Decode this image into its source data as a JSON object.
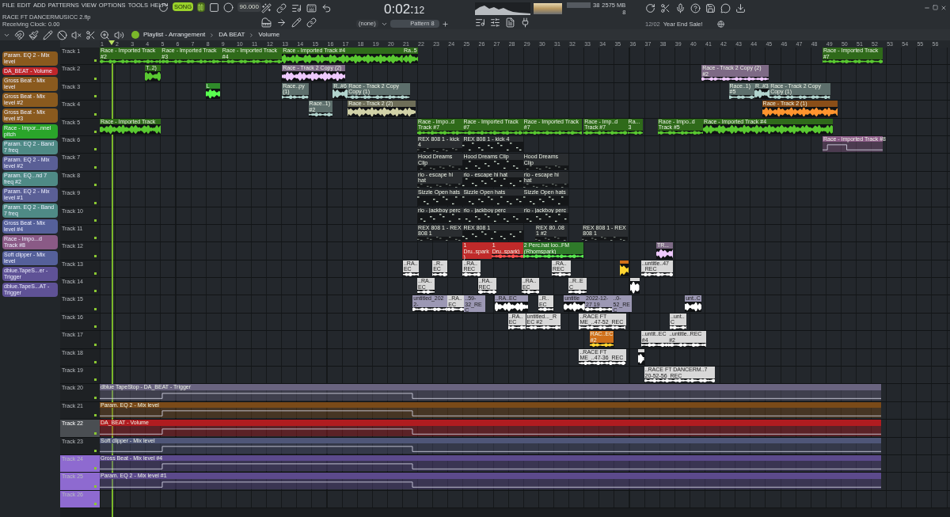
{
  "menu": [
    "FILE",
    "EDIT",
    "ADD",
    "PATTERNS",
    "VIEW",
    "OPTIONS",
    "TOOLS",
    "HELP"
  ],
  "project": {
    "file": "RACE FT DANCERMUSICC 2.flp",
    "status": "Receiving Clock: 0.00"
  },
  "transport": {
    "mode": "SONG",
    "playing": true,
    "tempo": "90.000",
    "time": "0:02:",
    "time_small": "12"
  },
  "monitor": {
    "cpu": "38",
    "memory": "2575 MB",
    "polyphony": "8"
  },
  "pattern": {
    "channel": "(none)",
    "name": "Pattern 8"
  },
  "news": {
    "date": "12/02",
    "text": "Year End Sale!"
  },
  "playlist": {
    "crumbs": [
      "Playlist - Arrangement",
      "DA BEAT",
      "Volume"
    ]
  },
  "sidebar": [
    {
      "label": "Param. EQ 2 - Mix level",
      "color": "#8a5a1e"
    },
    {
      "label": "DA_BEAT - Volume",
      "color": "#c0262a"
    },
    {
      "label": "Gross Beat - Mix level",
      "color": "#8a5a1e"
    },
    {
      "label": "Gross Beat - Mix level #2",
      "color": "#8a5a1e"
    },
    {
      "label": "Gross Beat - Mix level #3",
      "color": "#8a5a1e"
    },
    {
      "label": "Race - Impor...nnel pitch",
      "color": "#2aa52a"
    },
    {
      "label": "Param. EQ 2 - Band 7 freq",
      "color": "#4f8a86"
    },
    {
      "label": "Param. EQ 2 - Mix level #2",
      "color": "#5a5f96"
    },
    {
      "label": "Param. EQ...nd 7 freq #2",
      "color": "#4f8a86"
    },
    {
      "label": "Param. EQ 2 - Mix level #1",
      "color": "#5a5f96"
    },
    {
      "label": "Param. EQ 2 - Band 7 freq",
      "color": "#4f8a86"
    },
    {
      "label": "Gross Beat - Mix level #4",
      "color": "#55609a"
    },
    {
      "label": "Race - Impo...d Track #8",
      "color": "#8a5a86"
    },
    {
      "label": "Soft clipper - Mix level",
      "color": "#55609a"
    },
    {
      "label": "dblue.TapeS...er - Trigger",
      "color": "#5f5296"
    },
    {
      "label": "dblue.TapeS...AT - Trigger",
      "color": "#5f5296"
    }
  ],
  "ruler": [
    "1",
    "2",
    "3",
    "4",
    "5",
    "6",
    "7",
    "8",
    "9",
    "10",
    "11",
    "12",
    "13",
    "14",
    "15",
    "16",
    "17",
    "18",
    "19",
    "20",
    "21",
    "22",
    "23",
    "24",
    "25",
    "26",
    "27",
    "28",
    "29",
    "30",
    "31",
    "32",
    "33",
    "34",
    "35",
    "36",
    "37",
    "38",
    "39",
    "40",
    "41",
    "42",
    "43",
    "44",
    "45",
    "46",
    "47",
    "48",
    "49",
    "50",
    "51",
    "52",
    "53",
    "54",
    "55",
    "56"
  ],
  "tracks": [
    {
      "name": "Track 1",
      "selected": false,
      "clips": [
        {
          "kind": "audio",
          "label": "Race - Imported Track #2",
          "color": "#2f6a1a"
        },
        {
          "kind": "audio",
          "label": "Race - Imported Track #3",
          "color": "#2f6a1a"
        },
        {
          "kind": "audio",
          "label": "Race - Imported Track #4",
          "color": "#2f6a1a"
        },
        {
          "kind": "audio",
          "label": "Race - Imported Track #4",
          "color": "#2f6a1a"
        },
        {
          "kind": "audio",
          "label": "Ra..5",
          "color": "#2f6a1a"
        },
        {
          "kind": "audio",
          "label": "Race - Imported Track #7",
          "color": "#2f6a1a"
        }
      ]
    },
    {
      "name": "Track 2",
      "selected": false,
      "clips": [
        {
          "kind": "audio",
          "label": "T..2)",
          "color": "#2f6a1a"
        },
        {
          "kind": "audio",
          "label": "Race - Track 2 Copy (2)",
          "color": "#7e6a86"
        },
        {
          "kind": "audio",
          "label": "Race - Track 2 Copy (2) #2",
          "color": "#7e6a86"
        }
      ]
    },
    {
      "name": "Track 3",
      "selected": false,
      "clips": [
        {
          "kind": "audio",
          "label": "L",
          "color": "#2f8a2a"
        },
        {
          "kind": "audio",
          "label": "Race..py (1)",
          "color": "#5d6f6c"
        },
        {
          "kind": "audio",
          "label": "R..#6",
          "color": "#5d6f6c"
        },
        {
          "kind": "audio",
          "label": "Race - Track 2 Copy Copy (1)",
          "color": "#5d6f6c"
        },
        {
          "kind": "audio",
          "label": "Race..1) #5",
          "color": "#5d6f6c"
        },
        {
          "kind": "audio",
          "label": "R..#3",
          "color": "#5d6f6c"
        },
        {
          "kind": "audio",
          "label": "Race - Track 2 Copy Copy (1)",
          "color": "#5d6f6c"
        }
      ]
    },
    {
      "name": "Track 4",
      "selected": false,
      "clips": [
        {
          "kind": "audio",
          "label": "Race..1) #2",
          "color": "#5d6f6c"
        },
        {
          "kind": "audio",
          "label": "Race - Track 2 (2)",
          "color": "#6e6e58"
        },
        {
          "kind": "audio",
          "label": "Race - Track 2 (1)",
          "color": "#8a4e18"
        }
      ]
    },
    {
      "name": "Track 5",
      "selected": false,
      "clips": [
        {
          "kind": "audio",
          "label": "Race - Imported Track",
          "color": "#2f6a1a"
        },
        {
          "kind": "audio",
          "label": "Race - Impo..d Track #7",
          "color": "#2f6a1a"
        },
        {
          "kind": "audio",
          "label": "Race - Imported Track #7",
          "color": "#2f6a1a"
        },
        {
          "kind": "audio",
          "label": "Race - Imported Track #7",
          "color": "#2f6a1a"
        },
        {
          "kind": "audio",
          "label": "Race - Imp..d Track #7",
          "color": "#2f6a1a"
        },
        {
          "kind": "audio",
          "label": "Ra...3",
          "color": "#2f6a1a"
        },
        {
          "kind": "audio",
          "label": "Race - Impo..d Track #5",
          "color": "#2f6a1a"
        },
        {
          "kind": "audio",
          "label": "Race - Imported Track #4",
          "color": "#2f6a1a"
        }
      ]
    },
    {
      "name": "Track 6",
      "selected": false,
      "clips": [
        {
          "kind": "pattern",
          "label": "REX 808 1 - kick 4",
          "color": "#2a2d30"
        },
        {
          "kind": "pattern",
          "label": "REX 808 1 - kick 4",
          "color": "#2a2d30"
        },
        {
          "kind": "automation",
          "label": "Race - Imported Track #8",
          "color": "#8a5a86"
        }
      ]
    },
    {
      "name": "Track 7",
      "selected": false,
      "clips": [
        {
          "kind": "pattern",
          "label": "Hood Dreams Clip",
          "color": "#2a2d30"
        },
        {
          "kind": "pattern",
          "label": "Hood Dreams Clip",
          "color": "#2a2d30"
        },
        {
          "kind": "pattern",
          "label": "Hood Dreams Clip",
          "color": "#2a2d30"
        }
      ]
    },
    {
      "name": "Track 8",
      "selected": false,
      "clips": [
        {
          "kind": "pattern",
          "label": "rio - escape hi hat",
          "color": "#2a2d30"
        },
        {
          "kind": "pattern",
          "label": "rio - escape hi hat",
          "color": "#2a2d30"
        },
        {
          "kind": "pattern",
          "label": "rio - escape hi hat",
          "color": "#2a2d30"
        }
      ]
    },
    {
      "name": "Track 9",
      "selected": false,
      "clips": [
        {
          "kind": "pattern",
          "label": "Sizzle Open hats",
          "color": "#2a2d30"
        },
        {
          "kind": "pattern",
          "label": "Sizzle Open hats",
          "color": "#2a2d30"
        },
        {
          "kind": "pattern",
          "label": "Sizzle Open hats",
          "color": "#2a2d30"
        }
      ]
    },
    {
      "name": "Track 10",
      "selected": false,
      "clips": [
        {
          "kind": "pattern",
          "label": "rio - jackboy perc",
          "color": "#2a2d30"
        },
        {
          "kind": "pattern",
          "label": "rio - jackboy perc",
          "color": "#2a2d30"
        },
        {
          "kind": "pattern",
          "label": "rio - jackboy perc",
          "color": "#2a2d30"
        }
      ]
    },
    {
      "name": "Track 11",
      "selected": false,
      "clips": [
        {
          "kind": "pattern",
          "label": "REX 808 1 - REX 808 1",
          "color": "#2a2d30"
        },
        {
          "kind": "pattern",
          "label": "REX 808 1",
          "color": "#2a2d30"
        },
        {
          "kind": "pattern",
          "label": "REX 80..08 1 #2",
          "color": "#2a2d30"
        },
        {
          "kind": "pattern",
          "label": "REX 808 1 - REX 808 1",
          "color": "#2a2d30"
        }
      ]
    },
    {
      "name": "Track 12",
      "selected": false,
      "clips": [
        {
          "kind": "audio",
          "label": "1 Dru..spark)",
          "color": "#c02a2a"
        },
        {
          "kind": "audio",
          "label": "1 Dru..spark)",
          "color": "#c02a2a"
        },
        {
          "kind": "audio",
          "label": "2 Perc.hat loo..FM (Rhomspark)",
          "color": "#2f7a2a"
        },
        {
          "kind": "audio",
          "label": "TR...",
          "color": "#7e6a86"
        }
      ]
    },
    {
      "name": "Track 13",
      "selected": false,
      "clips": [
        {
          "kind": "audio",
          "label": "..RA..EC",
          "color": "#d8d8d8"
        },
        {
          "kind": "audio",
          "label": "..R..EC",
          "color": "#d8d8d8"
        },
        {
          "kind": "audio",
          "label": "..RA..REC",
          "color": "#d8d8d8"
        },
        {
          "kind": "audio",
          "label": "..RA..REC",
          "color": "#d8d8d8"
        },
        {
          "kind": "audio",
          "color": "#d0701a"
        },
        {
          "kind": "audio",
          "label": "..untitle..47_REC",
          "color": "#d8d8d8"
        }
      ]
    },
    {
      "name": "Track 14",
      "selected": false,
      "clips": [
        {
          "kind": "audio",
          "label": "..RA..EC",
          "color": "#d8d8d8"
        },
        {
          "kind": "audio",
          "label": "..RA..REC",
          "color": "#d8d8d8"
        },
        {
          "kind": "audio",
          "label": "..RA..EC",
          "color": "#d8d8d8"
        },
        {
          "kind": "audio",
          "label": "..R..EC",
          "color": "#d8d8d8"
        },
        {
          "kind": "audio",
          "color": "#d8d8d8"
        }
      ]
    },
    {
      "name": "Track 15",
      "selected": false,
      "clips": [
        {
          "kind": "audio",
          "label": "untitled_2022-",
          "color": "#9c98b4"
        },
        {
          "kind": "audio",
          "label": "..RA..EC",
          "color": "#d8d8d8"
        },
        {
          "kind": "audio",
          "label": "..59-32_REC",
          "color": "#9c98b4"
        },
        {
          "kind": "audio",
          "label": "..RA..EC",
          "color": "#9c98b4"
        },
        {
          "kind": "audio",
          "label": "..R..EC",
          "color": "#d8d8d8"
        },
        {
          "kind": "audio",
          "label": "untitle",
          "color": "#9c98b4"
        },
        {
          "kind": "audio",
          "label": "2022-12-27 19",
          "color": "#9c98b4"
        },
        {
          "kind": "audio",
          "label": "..0-52_REC",
          "color": "#9c98b4"
        },
        {
          "kind": "audio",
          "label": "unt..C",
          "color": "#9c98b4"
        }
      ]
    },
    {
      "name": "Track 16",
      "selected": false,
      "clips": [
        {
          "kind": "audio",
          "label": "..RA..EC",
          "color": "#d8d8d8"
        },
        {
          "kind": "audio",
          "label": "untitled..._REC #2",
          "color": "#d8d8d8"
        },
        {
          "kind": "audio",
          "label": "..RACE FT ME_..47-52_REC",
          "color": "#d8d8d8"
        },
        {
          "kind": "audio",
          "label": "..unt..C",
          "color": "#d8d8d8"
        }
      ]
    },
    {
      "name": "Track 17",
      "selected": false,
      "clips": [
        {
          "kind": "audio",
          "label": "RAC..EC #2",
          "color": "#d0701a"
        },
        {
          "kind": "audio",
          "label": "..untit..EC #4",
          "color": "#d8d8d8"
        },
        {
          "kind": "audio",
          "label": "..untitle..REC #2",
          "color": "#d8d8d8"
        }
      ]
    },
    {
      "name": "Track 18",
      "selected": false,
      "clips": [
        {
          "kind": "audio",
          "label": "..RACE FT ME_..47-36_REC",
          "color": "#d8d8d8"
        },
        {
          "kind": "audio",
          "color": "#d8d8d8"
        }
      ]
    },
    {
      "name": "Track 19",
      "selected": false,
      "clips": [
        {
          "kind": "audio",
          "label": "..RACE FT DANCERM..7 20-52-56_REC",
          "color": "#d8d8d8"
        }
      ]
    },
    {
      "name": "Track 20",
      "selected": false,
      "clips": [
        {
          "kind": "automation",
          "label": "dblue TapeStop - DA_BEAT - Trigger",
          "color": "#6a6480"
        }
      ]
    },
    {
      "name": "Track 21",
      "selected": false,
      "clips": [
        {
          "kind": "automation",
          "label": "Param. EQ 2 - Mix level",
          "color": "#7a4a18"
        }
      ]
    },
    {
      "name": "Track 22",
      "selected": true,
      "clips": [
        {
          "kind": "automation",
          "label": "DA_BEAT - Volume",
          "color": "#b01c20"
        }
      ]
    },
    {
      "name": "Track 23",
      "selected": false,
      "clips": [
        {
          "kind": "automation",
          "label": "Soft clipper - Mix level",
          "color": "#4f5678"
        }
      ]
    },
    {
      "name": "Track 24",
      "selected": false,
      "color": "#8e6ad0",
      "clips": [
        {
          "kind": "automation",
          "label": "Gross Beat - Mix level #4",
          "color": "#5c4a8c"
        }
      ]
    },
    {
      "name": "Track 25",
      "selected": false,
      "color": "#8e6ad0",
      "clips": [
        {
          "kind": "automation",
          "label": "Param. EQ 2 - Mix level #1",
          "color": "#5c4a8c"
        }
      ]
    },
    {
      "name": "Track 26",
      "selected": false,
      "color": "#8e6ad0"
    }
  ]
}
